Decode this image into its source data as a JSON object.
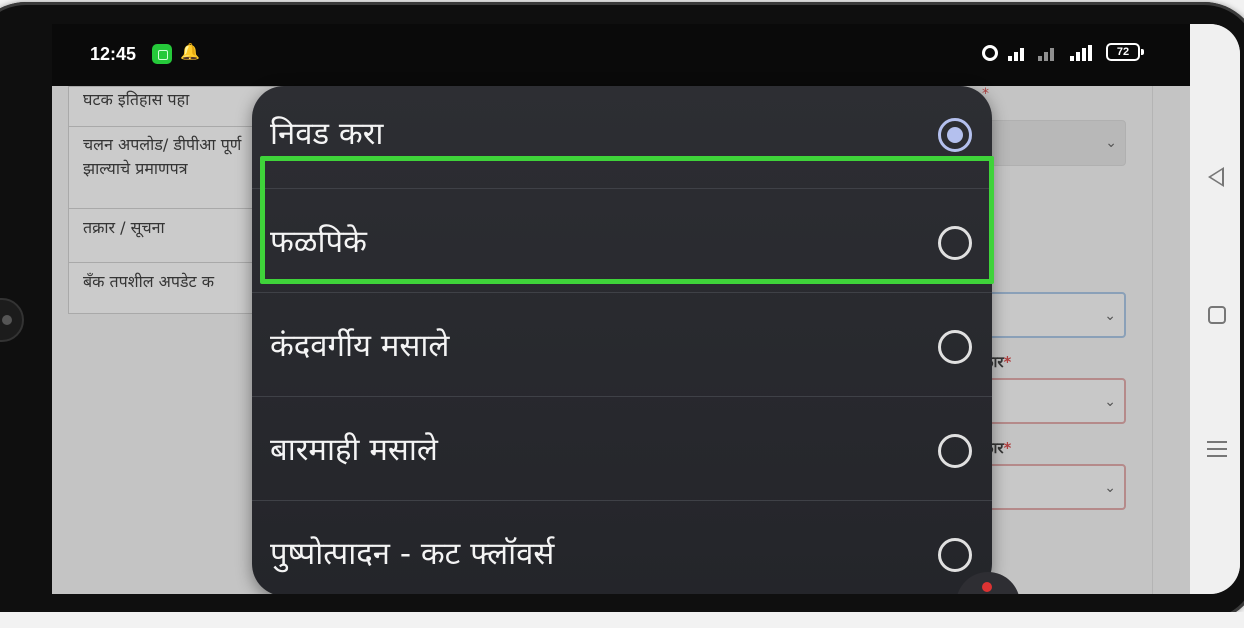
{
  "status_bar": {
    "time": "12:45",
    "battery": "72",
    "icons": [
      "app-notification-icon",
      "bell-icon",
      "alarm-icon",
      "signal-icon",
      "battery-icon"
    ]
  },
  "background_page": {
    "menu_items": [
      "घटक इतिहास पहा",
      "चलन अपलोड/ डीपीआ पूर्ण झाल्याचे प्रमाणपत्र",
      "तक्रार / सूचना",
      "बँक तपशील अपडेट क"
    ],
    "label_c": "कार",
    "label_d": "कार",
    "required_mark": "*"
  },
  "dialog": {
    "options": [
      {
        "label": "निवड करा",
        "selected": true
      },
      {
        "label": "फळपिके",
        "selected": false
      },
      {
        "label": "कंदवर्गीय मसाले",
        "selected": false
      },
      {
        "label": "बारमाही मसाले",
        "selected": false
      },
      {
        "label": "पुष्पोत्पादन - कट फ्लॉवर्स",
        "selected": false
      }
    ],
    "highlighted_option": "फळपिके"
  },
  "colors": {
    "dialog_bg": "#2d2e33",
    "radio_selected": "#b4c0ee",
    "highlight": "#3fd33a"
  }
}
